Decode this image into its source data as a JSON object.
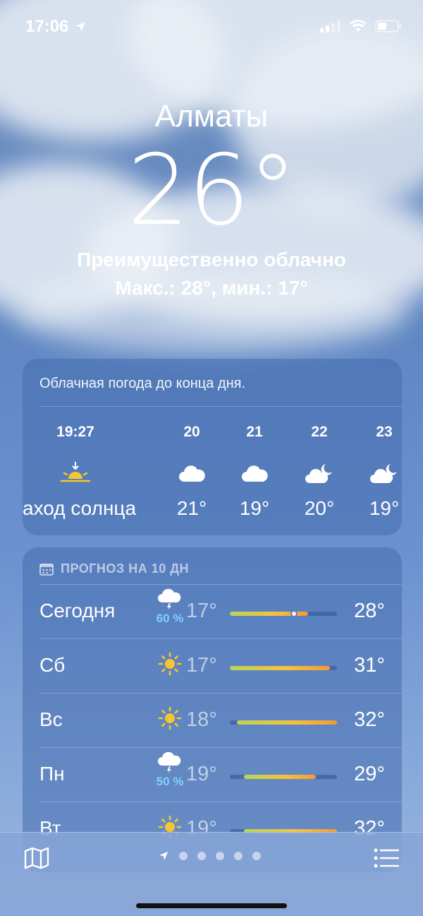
{
  "status": {
    "time": "17:06"
  },
  "header": {
    "city": "Алматы",
    "temperature": "26°",
    "condition": "Преимущественно облачно",
    "hilo": "Макс.: 28°, мин.: 17°"
  },
  "hourly": {
    "summary": "Облачная погода до конца дня.",
    "items": [
      {
        "label": "19:27",
        "icon": "sunset-icon",
        "value": "аход солнца"
      },
      {
        "label": "20",
        "icon": "cloud-icon",
        "value": "21°"
      },
      {
        "label": "21",
        "icon": "cloud-icon",
        "value": "19°"
      },
      {
        "label": "22",
        "icon": "cloud-moon-icon",
        "value": "20°"
      },
      {
        "label": "23",
        "icon": "cloud-moon-icon",
        "value": "19°"
      }
    ]
  },
  "daily": {
    "title": "ПРОГНОЗ НА 10 ДН",
    "range": [
      17,
      32
    ],
    "current_temp": 26,
    "rows": [
      {
        "day": "Сегодня",
        "icon": "thunderstorm-icon",
        "prob": "60 %",
        "lo": "17°",
        "hi": "28°",
        "lo_val": 17,
        "hi_val": 28
      },
      {
        "day": "Сб",
        "icon": "sun-icon",
        "prob": "",
        "lo": "17°",
        "hi": "31°",
        "lo_val": 17,
        "hi_val": 31
      },
      {
        "day": "Вс",
        "icon": "sun-icon",
        "prob": "",
        "lo": "18°",
        "hi": "32°",
        "lo_val": 18,
        "hi_val": 32
      },
      {
        "day": "Пн",
        "icon": "thunderstorm-icon",
        "prob": "50 %",
        "lo": "19°",
        "hi": "29°",
        "lo_val": 19,
        "hi_val": 29
      },
      {
        "day": "Вт",
        "icon": "sun-icon",
        "prob": "",
        "lo": "19°",
        "hi": "32°",
        "lo_val": 19,
        "hi_val": 32
      }
    ]
  },
  "toolbar": {
    "page_count": 5,
    "active_is_location": true
  }
}
